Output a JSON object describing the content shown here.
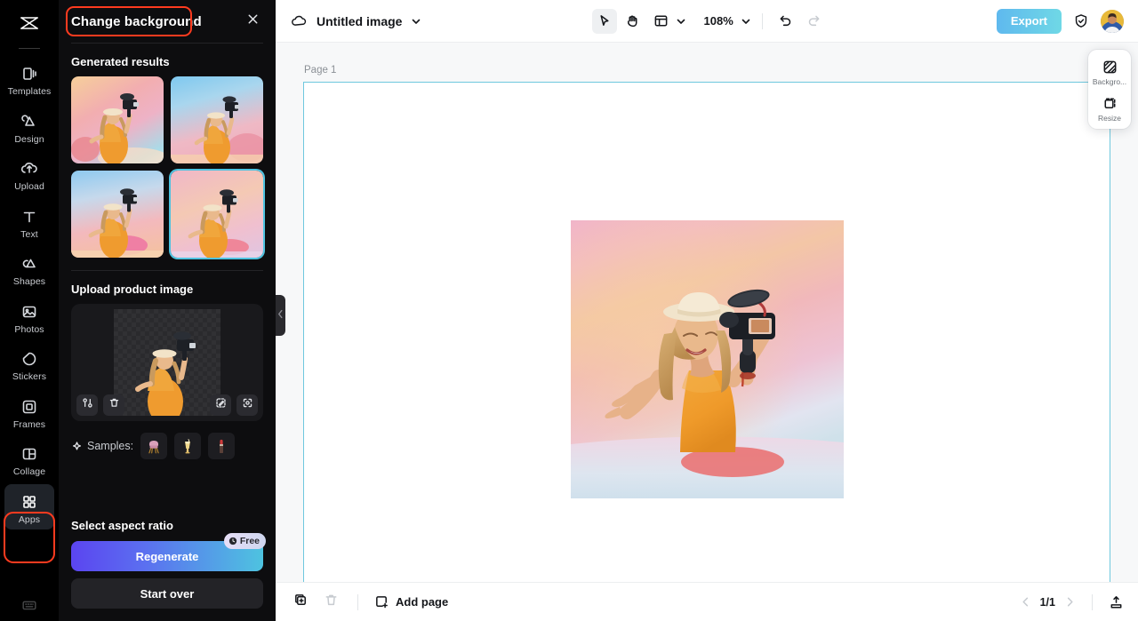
{
  "app": {
    "logo_icon": "capcut-logo-icon"
  },
  "rail": {
    "items": [
      {
        "label": "Templates",
        "icon": "templates-icon",
        "active": false
      },
      {
        "label": "Design",
        "icon": "design-icon",
        "active": false
      },
      {
        "label": "Upload",
        "icon": "upload-icon",
        "active": false
      },
      {
        "label": "Text",
        "icon": "text-icon",
        "active": false
      },
      {
        "label": "Shapes",
        "icon": "shapes-icon",
        "active": false
      },
      {
        "label": "Photos",
        "icon": "photos-icon",
        "active": false
      },
      {
        "label": "Stickers",
        "icon": "stickers-icon",
        "active": false
      },
      {
        "label": "Frames",
        "icon": "frames-icon",
        "active": false
      },
      {
        "label": "Collage",
        "icon": "collage-icon",
        "active": false
      },
      {
        "label": "Apps",
        "icon": "apps-grid-icon",
        "active": true
      }
    ],
    "bottom_icon": "keyboard-shortcuts-icon",
    "highlight_color": "#ff3b1f",
    "highlighted_item": "Apps"
  },
  "panel": {
    "title": "Change background",
    "title_highlight_color": "#ff3b1f",
    "close_icon": "close-icon",
    "generated_results": {
      "heading": "Generated results",
      "selected_index": 3,
      "selection_color": "#4ec3e0",
      "thumbs": [
        {
          "name": "result-1",
          "gradient": "linear-gradient(150deg,#f6cf9a 0%,#f2aeb0 35%,#eeb2c6 60%,#a9dbe8 88%,#cfe7ef 100%)"
        },
        {
          "name": "result-2",
          "gradient": "linear-gradient(165deg,#7ec8ef 0%,#a9d6ee 28%,#efb9c5 62%,#f0a9b8 100%)"
        },
        {
          "name": "result-3",
          "gradient": "linear-gradient(170deg,#8ec9ef 0%,#c6d9ec 30%,#f3b9bd 62%,#f5c29d 100%)"
        },
        {
          "name": "result-4",
          "gradient": "linear-gradient(160deg,#f0b7c8 0%,#f4c9b4 40%,#f0c0cf 70%,#dfc5e2 100%)"
        }
      ]
    },
    "upload": {
      "heading": "Upload product image",
      "tools": [
        {
          "name": "replace-image-icon",
          "title": "Replace"
        },
        {
          "name": "delete-icon",
          "title": "Delete"
        },
        {
          "name": "magic-eraser-icon",
          "title": "Erase"
        },
        {
          "name": "auto-fit-icon",
          "title": "Auto fit"
        }
      ]
    },
    "samples": {
      "label": "Samples:",
      "sparkle_icon": "sparkle-icon",
      "items": [
        {
          "name": "sample-chair",
          "alt": "pink chair"
        },
        {
          "name": "sample-drink",
          "alt": "milkshake glass"
        },
        {
          "name": "sample-lipstick",
          "alt": "lipstick"
        }
      ]
    },
    "aspect_ratio": {
      "heading": "Select aspect ratio"
    },
    "actions": {
      "regenerate_label": "Regenerate",
      "free_badge_label": "Free",
      "free_badge_icon": "credit-clock-icon",
      "start_over_label": "Start over"
    },
    "collapse_handle_icon": "chevron-left-icon"
  },
  "topbar": {
    "cloud_icon": "cloud-saved-icon",
    "doc_title": "Untitled image",
    "title_caret_icon": "chevron-down-icon",
    "tools": [
      {
        "name": "select-tool",
        "icon": "cursor-arrow-icon",
        "active": true
      },
      {
        "name": "hand-tool",
        "icon": "hand-icon",
        "active": false
      },
      {
        "name": "layout-tool",
        "icon": "layout-panel-icon",
        "active": false
      }
    ],
    "layout_caret_icon": "chevron-down-icon",
    "zoom_level": "108%",
    "zoom_caret_icon": "chevron-down-icon",
    "undo_icon": "undo-icon",
    "redo_icon": "redo-icon",
    "export_label": "Export",
    "shield_icon": "shield-check-icon",
    "avatar_name": "user-avatar",
    "export_color": "#5fb9ee"
  },
  "canvas": {
    "page_label": "Page 1",
    "frame_border_color": "#6fc8de",
    "artwork": {
      "name": "background-changed-photo",
      "background_gradient": "linear-gradient(168deg,#f0b6c9 0%,#f3bfc2 18%,#f2c9a8 40%,#f0b9bc 60%,#ecc2d2 78%,#dfe3ef 92%,#cfe0ea 100%)"
    }
  },
  "float_panel": {
    "items": [
      {
        "label": "Backgro...",
        "icon": "background-icon",
        "name": "background-tool"
      },
      {
        "label": "Resize",
        "icon": "resize-icon",
        "name": "resize-tool"
      }
    ]
  },
  "bottombar": {
    "duplicate_icon": "duplicate-page-icon",
    "delete_icon": "delete-page-icon",
    "add_page_label": "Add page",
    "add_page_icon": "add-page-icon",
    "prev_icon": "chevron-left-icon",
    "page_indicator": "1/1",
    "next_icon": "chevron-right-icon",
    "fit_icon": "fit-to-screen-icon"
  }
}
